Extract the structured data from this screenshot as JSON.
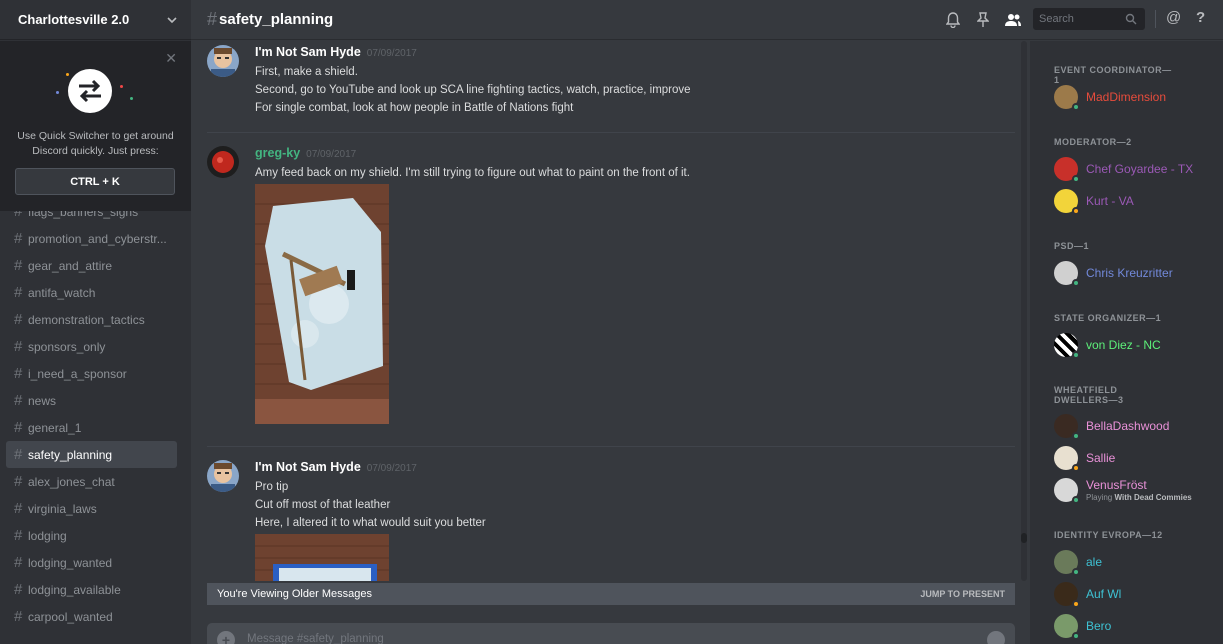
{
  "server": {
    "name": "Charlottesville 2.0"
  },
  "quick_switcher": {
    "description": "Use Quick Switcher to get around Discord quickly. Just press:",
    "shortcut": "CTRL + K"
  },
  "channels": [
    {
      "name": "flags_banners_signs"
    },
    {
      "name": "promotion_and_cyberstr..."
    },
    {
      "name": "gear_and_attire"
    },
    {
      "name": "antifa_watch"
    },
    {
      "name": "demonstration_tactics"
    },
    {
      "name": "sponsors_only"
    },
    {
      "name": "i_need_a_sponsor"
    },
    {
      "name": "news"
    },
    {
      "name": "general_1"
    },
    {
      "name": "safety_planning",
      "active": true
    },
    {
      "name": "alex_jones_chat"
    },
    {
      "name": "virginia_laws"
    },
    {
      "name": "lodging"
    },
    {
      "name": "lodging_wanted"
    },
    {
      "name": "lodging_available"
    },
    {
      "name": "carpool_wanted"
    }
  ],
  "header": {
    "hash": "#",
    "channel": "safety_planning",
    "search_placeholder": "Search",
    "at": "@",
    "help": "?"
  },
  "messages": [
    {
      "author": "I'm Not Sam Hyde",
      "author_color": "#ffffff",
      "timestamp": "07/09/2017",
      "lines": [
        "First, make a shield.",
        "Second, go to YouTube and look up SCA line fighting tactics, watch, practice, improve",
        "For single combat, look at how people in Battle of Nations fight"
      ]
    },
    {
      "author": "greg-ky",
      "author_color": "#43b581",
      "timestamp": "07/09/2017",
      "lines": [
        "Amy feed back on my shield. I'm still trying to figure out what to paint on the front of  it."
      ]
    },
    {
      "author": "I'm Not Sam Hyde",
      "author_color": "#ffffff",
      "timestamp": "07/09/2017",
      "lines": [
        "Pro tip",
        "Cut off most of that leather",
        "Here, I altered it to what would suit you better"
      ]
    }
  ],
  "older_bar": {
    "text": "You're Viewing Older Messages",
    "jump": "JUMP TO PRESENT"
  },
  "composer": {
    "placeholder": "Message #safety_planning"
  },
  "members": {
    "roles": [
      {
        "title": "EVENT COORDINATOR—1"
      },
      {
        "title": "MODERATOR—2"
      },
      {
        "title": "PSD—1"
      },
      {
        "title": "STATE ORGANIZER—1"
      },
      {
        "title": "WHEATFIELD DWELLERS—3"
      },
      {
        "title": "IDENTITY EVROPA—12"
      }
    ],
    "list": [
      {
        "name": "MadDimension",
        "color": "#e74c3c",
        "status": "online"
      },
      {
        "name": "Chef Goyardee - TX",
        "color": "#9b59b6",
        "status": "online"
      },
      {
        "name": "Kurt - VA",
        "color": "#9b59b6",
        "status": "idle"
      },
      {
        "name": "Chris Kreuzritter",
        "color": "#7289da",
        "status": "online"
      },
      {
        "name": "von Diez - NC",
        "color": "#5df07a",
        "status": "online"
      },
      {
        "name": "BellaDashwood",
        "color": "#e991d8",
        "status": "online"
      },
      {
        "name": "Sallie",
        "color": "#e991d8",
        "status": "idle"
      },
      {
        "name": "VenusFröst",
        "color": "#e991d8",
        "status": "online",
        "activity_prefix": "Playing",
        "activity_game": "With Dead Commies"
      },
      {
        "name": "ale",
        "color": "#3ec1d3",
        "status": "online"
      },
      {
        "name": "Auf Wl",
        "color": "#3ec1d3",
        "status": "idle"
      },
      {
        "name": "Bero",
        "color": "#3ec1d3",
        "status": "online"
      }
    ]
  },
  "colors": {
    "online": "#43b581",
    "idle": "#faa61a",
    "accent": "#7289da"
  }
}
